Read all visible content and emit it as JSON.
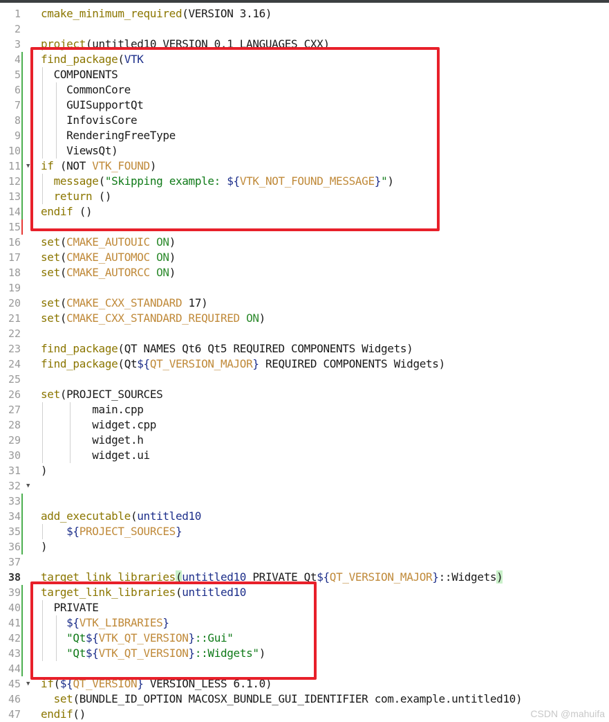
{
  "editor": {
    "lines": [
      "cmake_minimum_required(VERSION 3.16)",
      "",
      "project(untitled10 VERSION 0.1 LANGUAGES CXX)",
      "find_package(VTK",
      "  COMPONENTS",
      "    CommonCore",
      "    GUISupportQt",
      "    InfovisCore",
      "    RenderingFreeType",
      "    ViewsQt)",
      "if (NOT VTK_FOUND)",
      "  message(\"Skipping example: ${VTK_NOT_FOUND_MESSAGE}\")",
      "  return ()",
      "endif ()",
      "",
      "set(CMAKE_AUTOUIC ON)",
      "set(CMAKE_AUTOMOC ON)",
      "set(CMAKE_AUTORCC ON)",
      "",
      "set(CMAKE_CXX_STANDARD 17)",
      "set(CMAKE_CXX_STANDARD_REQUIRED ON)",
      "",
      "find_package(QT NAMES Qt6 Qt5 REQUIRED COMPONENTS Widgets)",
      "find_package(Qt${QT_VERSION_MAJOR} REQUIRED COMPONENTS Widgets)",
      "",
      "set(PROJECT_SOURCES",
      "        main.cpp",
      "        widget.cpp",
      "        widget.h",
      "        widget.ui",
      ")",
      "",
      "",
      "add_executable(untitled10",
      "    ${PROJECT_SOURCES}",
      ")",
      "",
      "target_link_libraries(untitled10 PRIVATE Qt${QT_VERSION_MAJOR}::Widgets)",
      "target_link_libraries(untitled10",
      "  PRIVATE",
      "    ${VTK_LIBRARIES}",
      "    \"Qt${VTK_QT_VERSION}::Gui\"",
      "    \"Qt${VTK_QT_VERSION}::Widgets\")",
      "",
      "if(${QT_VERSION} VERSION_LESS 6.1.0)",
      "  set(BUNDLE_ID_OPTION MACOSX_BUNDLE_GUI_IDENTIFIER com.example.untitled10)",
      "endif()"
    ],
    "current_line": 38,
    "fold_markers": [
      11,
      32,
      45
    ]
  },
  "colors": {
    "highlight_box": "#e8202a",
    "change_bar_added": "#4caf50",
    "change_bar_modified": "#e53935"
  },
  "watermark": "CSDN @mahuifa"
}
